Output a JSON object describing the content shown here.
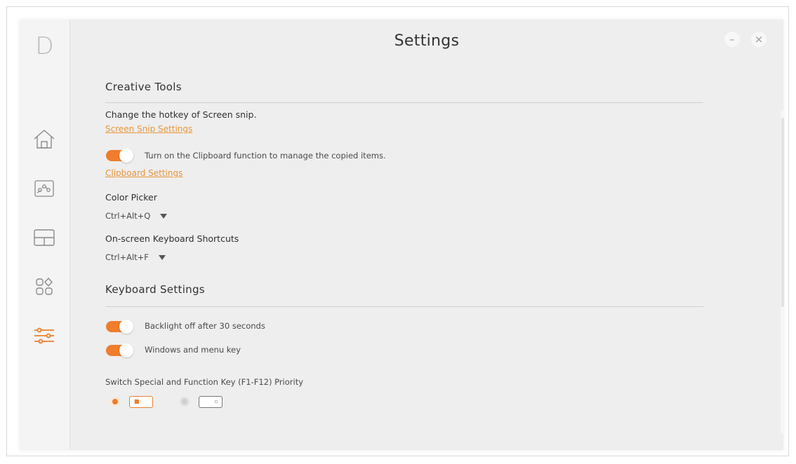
{
  "app": {
    "logo_letter": "D",
    "title": "Settings",
    "minimize_glyph": "–",
    "close_glyph": "×"
  },
  "sidebar": {
    "items": [
      {
        "icon": "home-icon",
        "active": false
      },
      {
        "icon": "gallery-icon",
        "active": false
      },
      {
        "icon": "layout-icon",
        "active": false
      },
      {
        "icon": "apps-icon",
        "active": false
      },
      {
        "icon": "sliders-icon",
        "active": true
      }
    ]
  },
  "creative_tools": {
    "heading": "Creative Tools",
    "screen_snip_text": "Change the hotkey of Screen snip.",
    "screen_snip_link": "Screen Snip Settings",
    "clipboard_toggle_label": "Turn on the Clipboard function to manage the copied items.",
    "clipboard_toggle_on": true,
    "clipboard_link": "Clipboard Settings",
    "color_picker_label": "Color Picker",
    "color_picker_value": "Ctrl+Alt+Q",
    "osk_label": "On-screen Keyboard Shortcuts",
    "osk_value": "Ctrl+Alt+F"
  },
  "keyboard_settings": {
    "heading": "Keyboard Settings",
    "backlight_label": "Backlight off after 30 seconds",
    "backlight_on": true,
    "windows_key_label": "Windows and menu key",
    "windows_key_on": true,
    "fn_priority_label": "Switch Special and Function Key (F1-F12) Priority",
    "fn_priority_selected": 0
  },
  "colors": {
    "accent": "#ef7d2c",
    "link": "#e8963a",
    "background": "#eeeeee",
    "sidebar": "#f4f4f4"
  }
}
